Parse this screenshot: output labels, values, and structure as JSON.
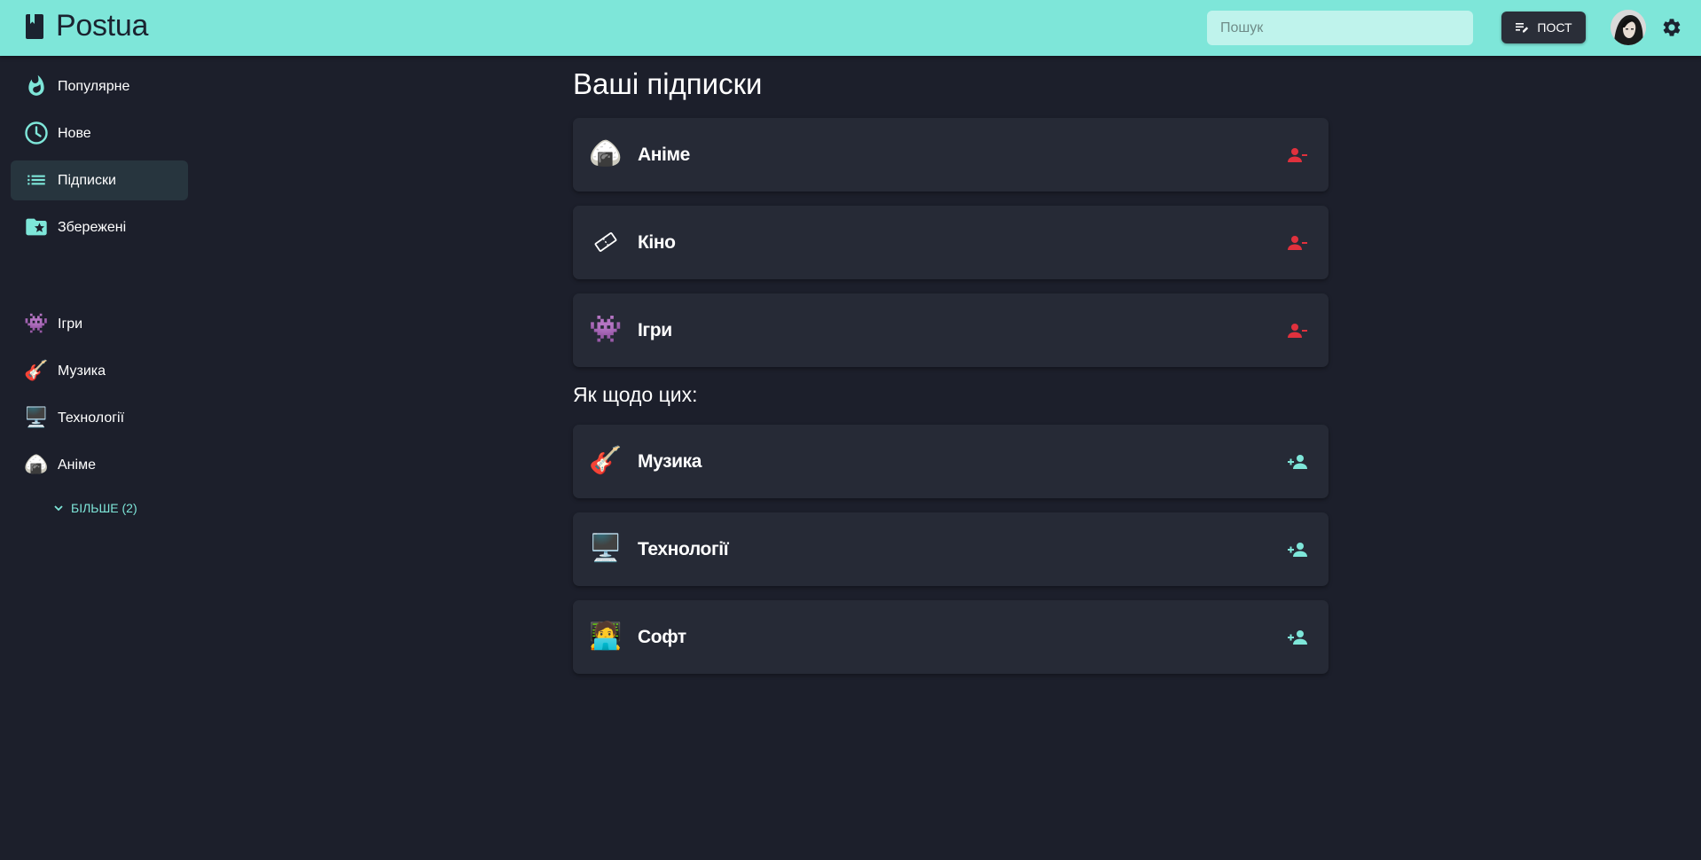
{
  "app": {
    "name": "Postua"
  },
  "header": {
    "search_placeholder": "Пошук",
    "post_label": "ПОСТ"
  },
  "sidebar": {
    "nav": [
      {
        "label": "Популярне",
        "icon": "flame-icon"
      },
      {
        "label": "Нове",
        "icon": "clock-icon"
      },
      {
        "label": "Підписки",
        "icon": "list-icon",
        "active": true
      },
      {
        "label": "Збережені",
        "icon": "folder-star-icon"
      }
    ],
    "communities": [
      {
        "label": "Ігри",
        "icon": "👾"
      },
      {
        "label": "Музика",
        "icon": "🎸"
      },
      {
        "label": "Технології",
        "icon": "🖥️"
      },
      {
        "label": "Аніме",
        "icon": "🍙"
      }
    ],
    "more_label": "БІЛЬШЕ (2)"
  },
  "main": {
    "subscriptions_title": "Ваші підписки",
    "subscriptions": [
      {
        "label": "Аніме",
        "icon": "🍙",
        "action": "unsubscribe"
      },
      {
        "label": "Кіно",
        "icon": "🎞",
        "action": "unsubscribe"
      },
      {
        "label": "Ігри",
        "icon": "👾",
        "action": "unsubscribe"
      }
    ],
    "suggestions_title": "Як щодо цих:",
    "suggestions": [
      {
        "label": "Музика",
        "icon": "🎸",
        "action": "subscribe"
      },
      {
        "label": "Технології",
        "icon": "🖥️",
        "action": "subscribe"
      },
      {
        "label": "Софт",
        "icon": "🧑‍💻",
        "action": "subscribe"
      }
    ]
  },
  "colors": {
    "accent": "#7ee6d9",
    "background": "#1c1f2b",
    "card": "#262a36",
    "unsubscribe": "#e0313d",
    "subscribe": "#7ee6d9"
  }
}
